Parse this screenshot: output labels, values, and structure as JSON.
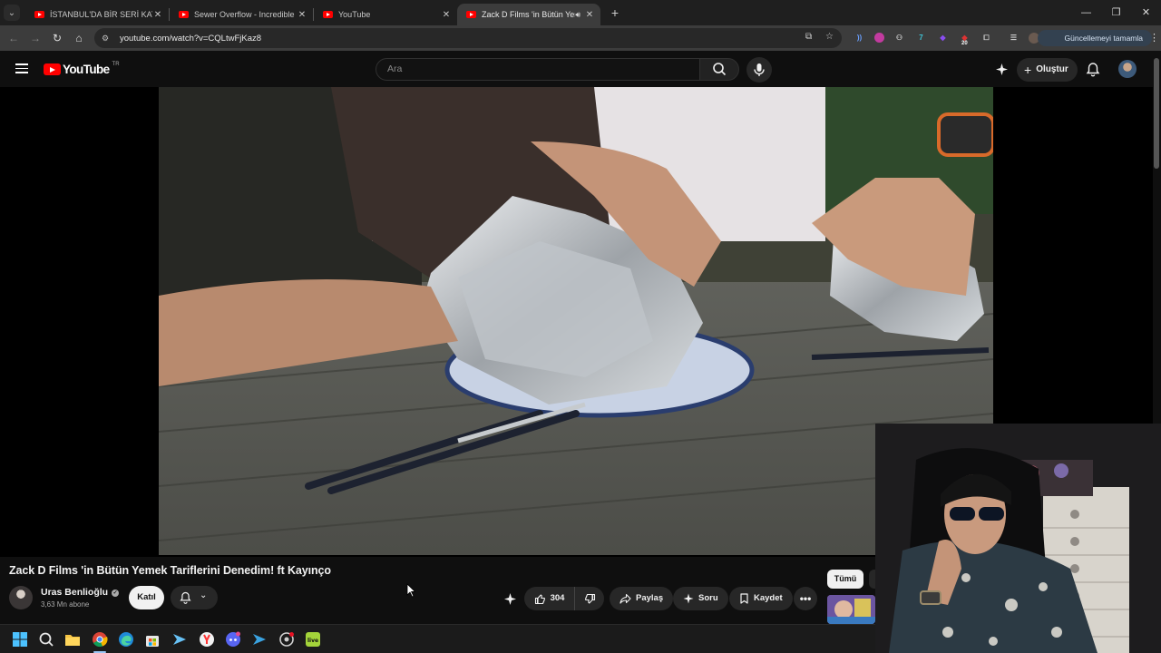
{
  "browser": {
    "tabs": [
      {
        "title": "İSTANBUL'DA BİR SERİ KATİL - ",
        "active": false,
        "audio": false
      },
      {
        "title": "Sewer Overflow - Incredible din",
        "active": false,
        "audio": false
      },
      {
        "title": "YouTube",
        "active": false,
        "audio": false
      },
      {
        "title": "Zack D Films 'in Bütün Yem",
        "active": true,
        "audio": true
      }
    ],
    "url": "youtube.com/watch?v=CQLtwFjKaz8",
    "update_label": "Güncellemeyi tamamla",
    "extension_badge": "20"
  },
  "youtube": {
    "logo_text": "YouTube",
    "country_code": "TR",
    "search_placeholder": "Ara",
    "create_label": "Oluştur"
  },
  "video": {
    "title": "Zack D Films 'in Bütün Yemek Tariflerini Denedim! ft Kayınço",
    "channel_name": "Uras Benlioğlu",
    "subscribers": "3,63 Mn abone",
    "join_label": "Katıl",
    "likes": "304",
    "share_label": "Paylaş",
    "ask_label": "Soru",
    "save_label": "Kaydet"
  },
  "recommendations": {
    "chip_all": "Tümü"
  },
  "colors": {
    "background": "#0f0f0f",
    "button_bg": "#272727",
    "brand_red": "#ff0000",
    "text_primary": "#f1f1f1",
    "text_secondary": "#aaaaaa"
  }
}
